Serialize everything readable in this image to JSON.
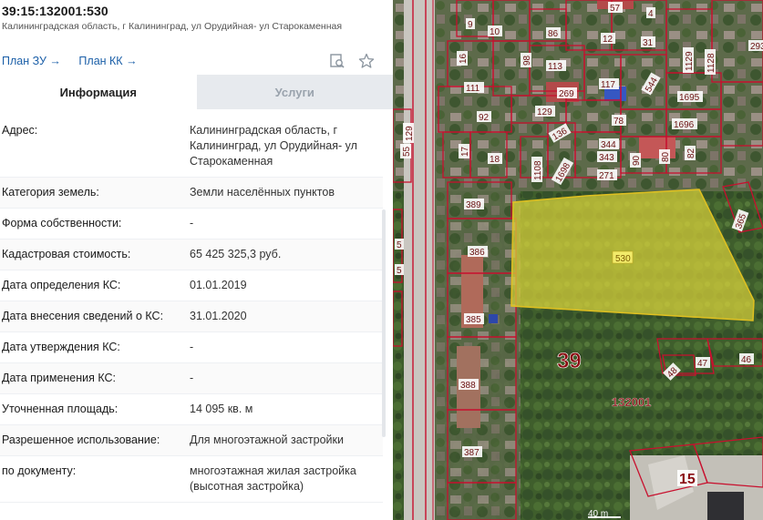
{
  "header": {
    "cadastral_number": "39:15:132001:530",
    "address_short": "Калининградская область, г Калининград, ул Орудийная- ул Старокаменная"
  },
  "links": [
    {
      "label": "План ЗУ →"
    },
    {
      "label": "План КК →"
    }
  ],
  "tabs": [
    {
      "label": "Информация",
      "active": true
    },
    {
      "label": "Услуги",
      "active": false
    }
  ],
  "info_rows": [
    {
      "key": "Адрес:",
      "value": "Калининградская область, г Калининград, ул Орудийная- ул Старокаменная"
    },
    {
      "key": "Категория земель:",
      "value": "Земли населённых пунктов"
    },
    {
      "key": "Форма собственности:",
      "value": "-"
    },
    {
      "key": "Кадастровая стоимость:",
      "value": "65 425 325,3 руб."
    },
    {
      "key": "Дата определения КС:",
      "value": "01.01.2019"
    },
    {
      "key": "Дата внесения сведений о КС:",
      "value": "31.01.2020"
    },
    {
      "key": "Дата утверждения КС:",
      "value": "-"
    },
    {
      "key": "Дата применения КС:",
      "value": "-"
    },
    {
      "key": "Уточненная площадь:",
      "value": "14 095 кв. м"
    },
    {
      "key": "Разрешенное использование:",
      "value": "Для многоэтажной застройки"
    },
    {
      "key": "по документу:",
      "value": "многоэтажная жилая застройка (высотная застройка)"
    }
  ],
  "map": {
    "district_number": "39",
    "quarter_number": "132001",
    "selected_parcel_label": "530",
    "parcel_labels": [
      "57",
      "4",
      "9",
      "10",
      "86",
      "12",
      "31",
      "293",
      "16",
      "98",
      "113",
      "1129",
      "1128",
      "111",
      "269",
      "117",
      "544",
      "1695",
      "92",
      "129",
      "78",
      "1696",
      "55",
      "129",
      "136",
      "17",
      "18",
      "344",
      "343",
      "1108",
      "1698",
      "90",
      "80",
      "82",
      "271",
      "389",
      "365",
      "5",
      "386",
      "5",
      "385",
      "388",
      "387",
      "48",
      "47",
      "46",
      "15"
    ],
    "scale_label": "40 m",
    "colors": {
      "selected_fill": "#d9d23a",
      "selected_stroke": "#e0c020",
      "boundary": "#c8102e",
      "label_text": "#6a1010",
      "big_label": "#8a0d12"
    }
  }
}
